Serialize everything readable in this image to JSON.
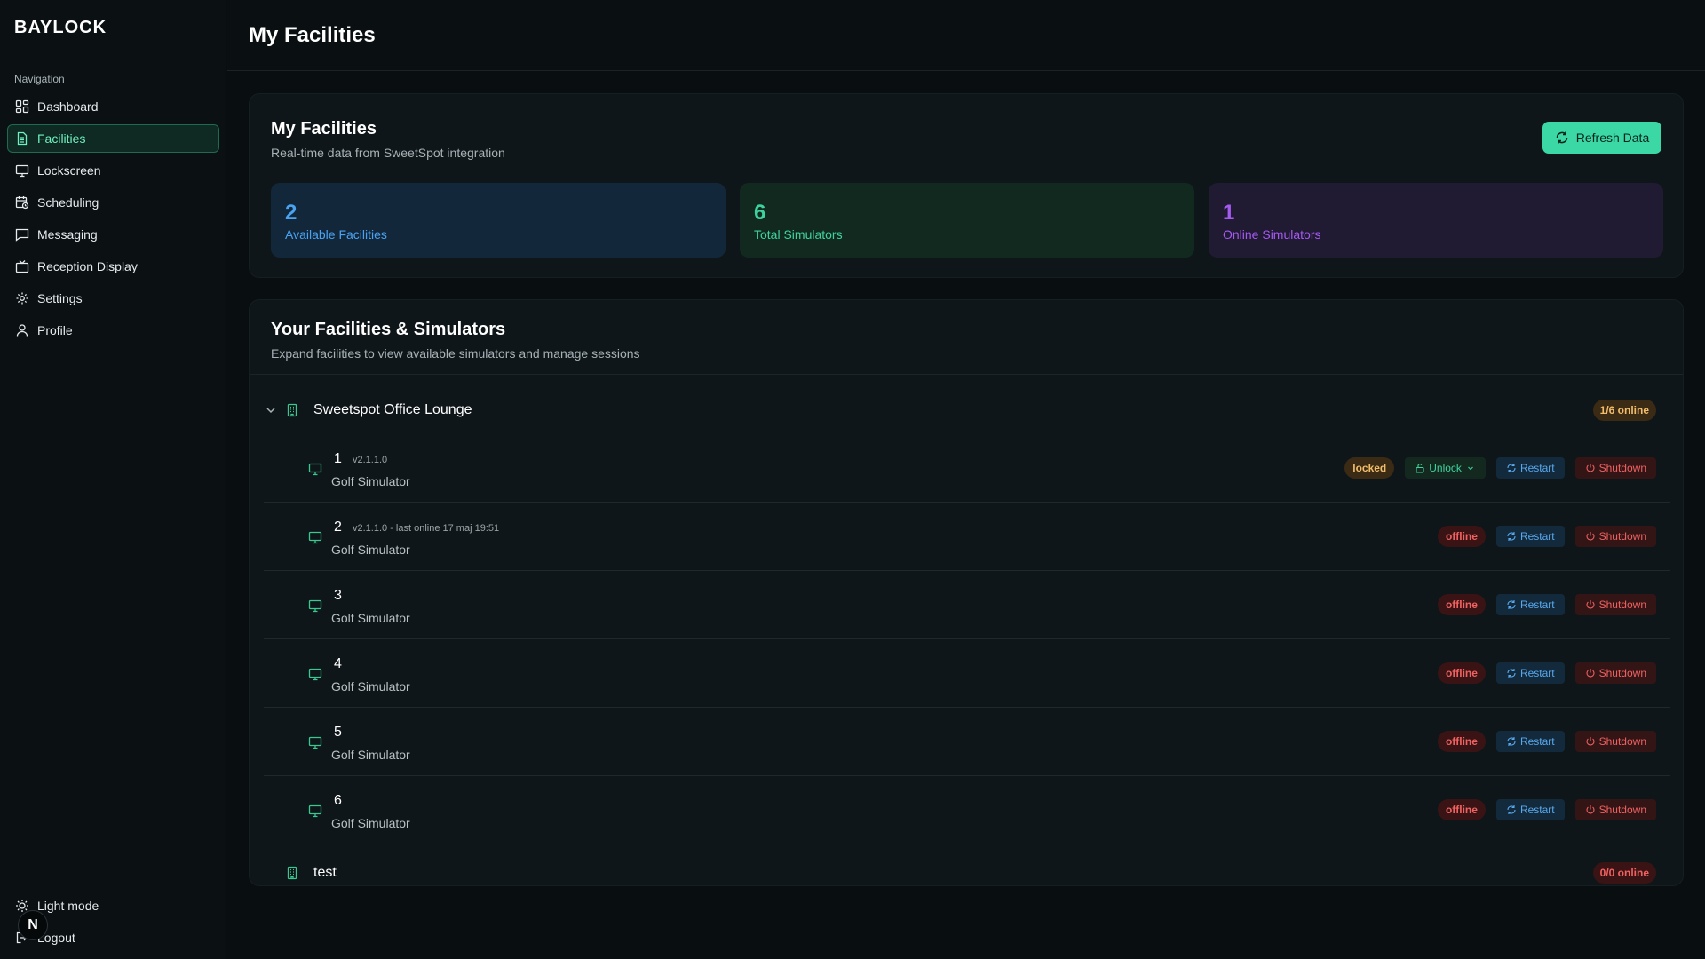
{
  "app": {
    "brand": "BAYLOCK"
  },
  "sidebar": {
    "heading": "Navigation",
    "items": [
      {
        "label": "Dashboard",
        "icon": "dashboard-icon"
      },
      {
        "label": "Facilities",
        "icon": "document-icon",
        "active": true
      },
      {
        "label": "Lockscreen",
        "icon": "monitor-icon"
      },
      {
        "label": "Scheduling",
        "icon": "calendar-clock-icon"
      },
      {
        "label": "Messaging",
        "icon": "message-icon"
      },
      {
        "label": "Reception Display",
        "icon": "tv-icon"
      },
      {
        "label": "Settings",
        "icon": "gear-icon"
      },
      {
        "label": "Profile",
        "icon": "user-icon"
      }
    ],
    "bottom": [
      {
        "label": "Light mode",
        "icon": "sun-icon"
      },
      {
        "label": "Logout",
        "icon": "logout-icon"
      }
    ],
    "avatar_letter": "N"
  },
  "header": {
    "title": "My Facilities"
  },
  "summary": {
    "title": "My Facilities",
    "subtitle": "Real-time data from SweetSpot integration",
    "refresh_label": "Refresh Data",
    "stats": [
      {
        "value": "2",
        "label": "Available Facilities",
        "color": "#4aa3f2"
      },
      {
        "value": "6",
        "label": "Total Simulators",
        "color": "#3ed29e"
      },
      {
        "value": "1",
        "label": "Online Simulators",
        "color": "#a55af0"
      }
    ]
  },
  "list": {
    "title": "Your Facilities & Simulators",
    "subtitle": "Expand facilities to view available simulators and manage sessions",
    "labels": {
      "unlock": "Unlock",
      "restart": "Restart",
      "shutdown": "Shutdown"
    },
    "facilities": [
      {
        "name": "Sweetspot Office Lounge",
        "online": "1/6 online",
        "simulators": [
          {
            "number": "1",
            "version": "v2.1.1.0",
            "type": "Golf Simulator",
            "status": "locked"
          },
          {
            "number": "2",
            "version": "v2.1.1.0 - last online 17 maj 19:51",
            "type": "Golf Simulator",
            "status": "offline"
          },
          {
            "number": "3",
            "version": "",
            "type": "Golf Simulator",
            "status": "offline"
          },
          {
            "number": "4",
            "version": "",
            "type": "Golf Simulator",
            "status": "offline"
          },
          {
            "number": "5",
            "version": "",
            "type": "Golf Simulator",
            "status": "offline"
          },
          {
            "number": "6",
            "version": "",
            "type": "Golf Simulator",
            "status": "offline"
          }
        ]
      },
      {
        "name": "test",
        "online": "0/0 online",
        "simulators": []
      }
    ]
  }
}
